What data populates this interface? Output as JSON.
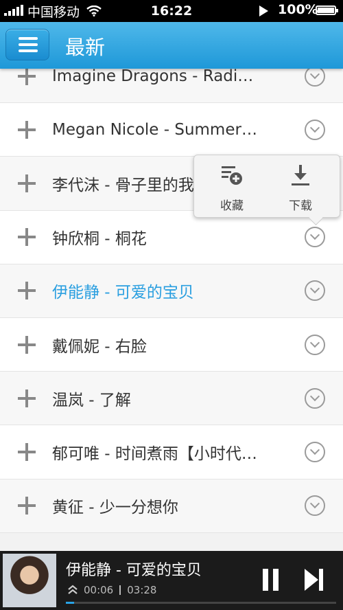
{
  "status_bar": {
    "carrier": "中国移动",
    "time": "16:22",
    "battery": "100%"
  },
  "header": {
    "title": "最新",
    "menu_icon": "menu-icon"
  },
  "songs": [
    {
      "text": "Imagine Dragons - Radi…",
      "active": false
    },
    {
      "text": "Megan Nicole - Summer…",
      "active": false
    },
    {
      "text": "李代沫 - 骨子里的我",
      "active": false
    },
    {
      "text": "钟欣桐 - 桐花",
      "active": false
    },
    {
      "text": "伊能静 - 可爱的宝贝",
      "active": true
    },
    {
      "text": "戴佩妮 - 右脸",
      "active": false
    },
    {
      "text": "温岚 - 了解",
      "active": false
    },
    {
      "text": "郁可唯 - 时间煮雨【小时代…",
      "active": false
    },
    {
      "text": "黄征 - 少一分想你",
      "active": false
    }
  ],
  "popup": {
    "collect_label": "收藏",
    "download_label": "下载"
  },
  "player": {
    "title": "伊能静 - 可爱的宝贝",
    "elapsed": "00:06",
    "duration": "03:28",
    "progress": 0.03,
    "accent": "#29a3e6"
  }
}
